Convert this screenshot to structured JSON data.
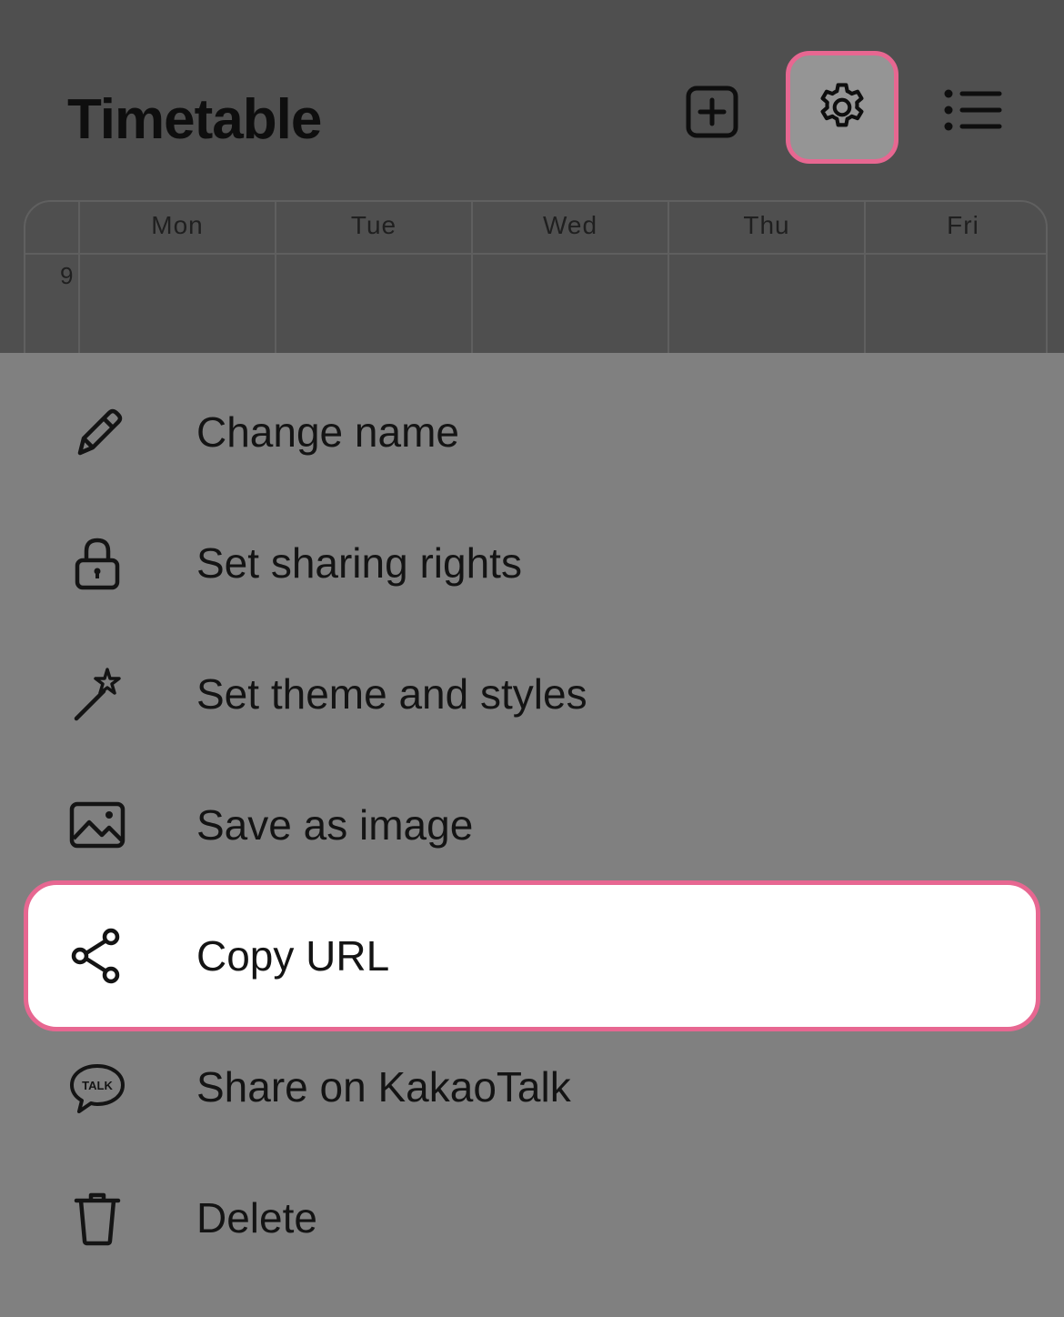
{
  "header": {
    "title": "Timetable",
    "icons": [
      "add-square-icon",
      "gear-icon",
      "list-icon"
    ]
  },
  "timetable": {
    "days": [
      "Mon",
      "Tue",
      "Wed",
      "Thu",
      "Fri"
    ],
    "hours": [
      "9"
    ]
  },
  "menu": {
    "items": [
      {
        "label": "Change name",
        "icon": "pencil-icon"
      },
      {
        "label": "Set sharing rights",
        "icon": "lock-icon"
      },
      {
        "label": "Set theme and styles",
        "icon": "magic-wand-icon"
      },
      {
        "label": "Save as image",
        "icon": "image-icon"
      },
      {
        "label": "Copy URL",
        "icon": "share-icon",
        "highlighted": true
      },
      {
        "label": "Share on KakaoTalk",
        "icon": "kakaotalk-icon"
      },
      {
        "label": "Delete",
        "icon": "trash-icon"
      }
    ]
  },
  "colors": {
    "highlight_border": "#e76791",
    "overlay_dark": "#4f4f4f",
    "sheet_bg": "#808080"
  }
}
